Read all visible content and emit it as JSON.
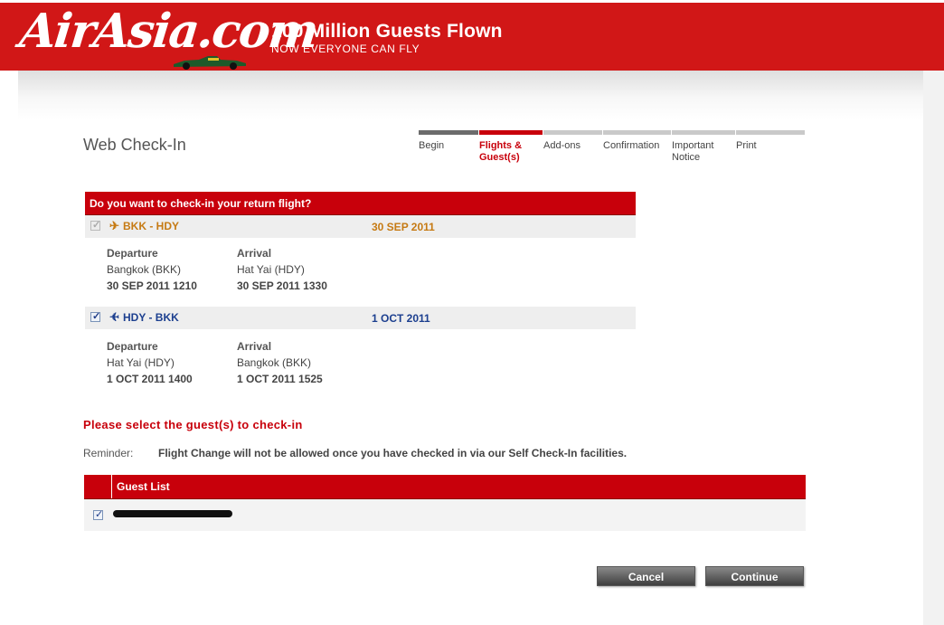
{
  "header": {
    "logo_text": "AirAsia.com",
    "headline": "100 Million Guests Flown",
    "subline": "NOW EVERYONE CAN FLY",
    "brand_color": "#d11717"
  },
  "page": {
    "title": "Web Check-In"
  },
  "steps": [
    {
      "label": "Begin",
      "state": "done"
    },
    {
      "label": "Flights & Guest(s)",
      "state": "current"
    },
    {
      "label": "Add-ons",
      "state": "pending"
    },
    {
      "label": "Confirmation",
      "state": "pending"
    },
    {
      "label": "Important Notice",
      "state": "pending"
    },
    {
      "label": "Print",
      "state": "pending"
    }
  ],
  "return_panel": {
    "heading": "Do you want to check-in your return flight?",
    "flights": [
      {
        "checked": true,
        "disabled": true,
        "icon": "plane-depart-icon",
        "route": "BKK - HDY",
        "date": "30 SEP 2011",
        "departure_label": "Departure",
        "departure_place": "Bangkok (BKK)",
        "departure_time": "30 SEP 2011 1210",
        "arrival_label": "Arrival",
        "arrival_place": "Hat Yai (HDY)",
        "arrival_time": "30 SEP 2011 1330"
      },
      {
        "checked": true,
        "disabled": false,
        "icon": "plane-return-icon",
        "route": "HDY - BKK",
        "date": "1 OCT 2011",
        "departure_label": "Departure",
        "departure_place": "Hat Yai (HDY)",
        "departure_time": "1 OCT 2011 1400",
        "arrival_label": "Arrival",
        "arrival_place": "Bangkok (BKK)",
        "arrival_time": "1 OCT 2011 1525"
      }
    ]
  },
  "guests": {
    "title": "Please select the guest(s) to check-in",
    "reminder_label": "Reminder:",
    "reminder_text": "Flight Change will not be allowed once you have checked in via our Self Check-In facilities.",
    "list_header": "Guest List",
    "rows": [
      {
        "checked": true,
        "name_redacted": true
      }
    ]
  },
  "buttons": {
    "cancel": "Cancel",
    "continue": "Continue"
  },
  "colors": {
    "accent_red": "#c8000b",
    "orange_text": "#c67a13",
    "blue_text": "#1c3f8f"
  }
}
